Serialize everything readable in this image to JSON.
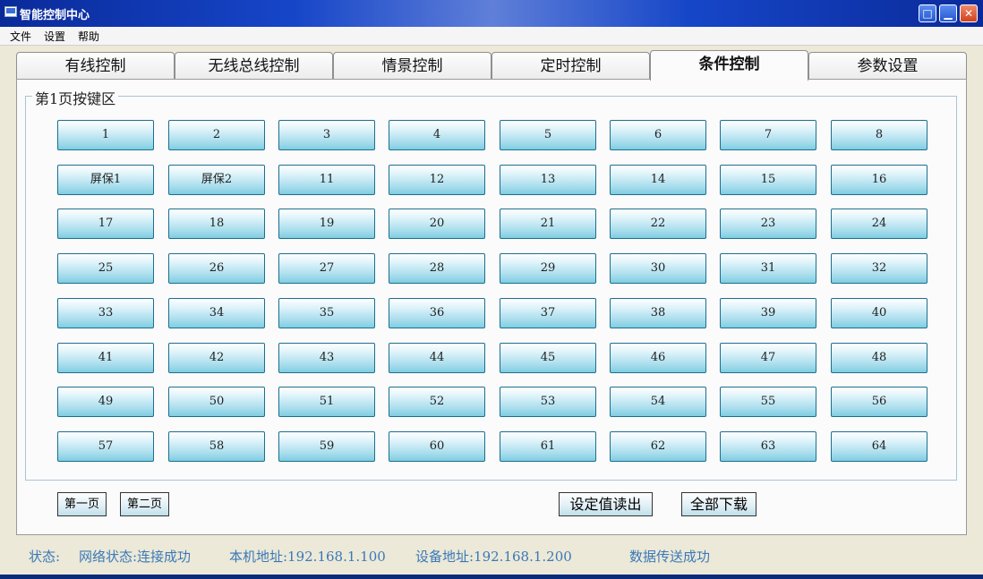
{
  "window": {
    "title": "智能控制中心",
    "controls": {
      "maximize": "□",
      "minimize": "▁",
      "close": "✕"
    }
  },
  "menu": [
    "文件",
    "设置",
    "帮助"
  ],
  "tabs": [
    "有线控制",
    "无线总线控制",
    "情景控制",
    "定时控制",
    "条件控制",
    "参数设置"
  ],
  "active_tab": "条件控制",
  "group": {
    "title": "第1页按键区",
    "keys": [
      "1",
      "2",
      "3",
      "4",
      "5",
      "6",
      "7",
      "8",
      "屏保1",
      "屏保2",
      "11",
      "12",
      "13",
      "14",
      "15",
      "16",
      "17",
      "18",
      "19",
      "20",
      "21",
      "22",
      "23",
      "24",
      "25",
      "26",
      "27",
      "28",
      "29",
      "30",
      "31",
      "32",
      "33",
      "34",
      "35",
      "36",
      "37",
      "38",
      "39",
      "40",
      "41",
      "42",
      "43",
      "44",
      "45",
      "46",
      "47",
      "48",
      "49",
      "50",
      "51",
      "52",
      "53",
      "54",
      "55",
      "56",
      "57",
      "58",
      "59",
      "60",
      "61",
      "62",
      "63",
      "64"
    ]
  },
  "page_buttons": {
    "first": "第一页",
    "second": "第二页"
  },
  "actions": {
    "read": "设定值读出",
    "download": "全部下载"
  },
  "status": {
    "label": "状态:",
    "network": "网络状态:连接成功",
    "local_ip": "本机地址:192.168.1.100",
    "device_ip": "设备地址:192.168.1.200",
    "transfer": "数据传送成功"
  },
  "colors": {
    "accent": "#3a78b8",
    "titlebar": "#1646c8",
    "key_border": "#1c6f8e"
  }
}
